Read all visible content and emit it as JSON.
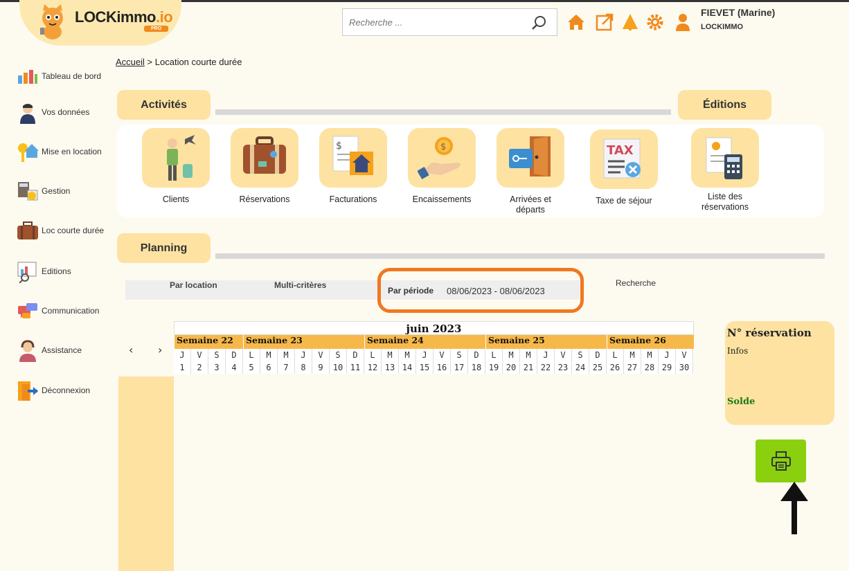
{
  "app": {
    "logo_text_main": "LOCKimmo",
    "logo_text_io": ".io",
    "logo_badge": "PRO"
  },
  "search": {
    "placeholder": "Recherche ...",
    "value": ""
  },
  "user": {
    "name": "FIEVET (Marine)",
    "org": "LOCKIMMO"
  },
  "top_icons": [
    "home-icon",
    "external-link-icon",
    "alert-icon",
    "gear-icon",
    "user-icon"
  ],
  "sidebar": {
    "items": [
      {
        "label": "Tableau de bord",
        "icon": "dashboard-icon"
      },
      {
        "label": "Vos données",
        "icon": "person-icon"
      },
      {
        "label": "Mise en location",
        "icon": "key-house-icon"
      },
      {
        "label": "Gestion",
        "icon": "calculator-icon"
      },
      {
        "label": "Loc courte durée",
        "icon": "suitcase-icon"
      },
      {
        "label": "Editions",
        "icon": "report-icon"
      },
      {
        "label": "Communication",
        "icon": "chat-icon"
      },
      {
        "label": "Assistance",
        "icon": "support-icon"
      },
      {
        "label": "Déconnexion",
        "icon": "logout-icon"
      }
    ]
  },
  "breadcrumb": {
    "home": "Accueil",
    "sep": ">",
    "current": "Location courte durée"
  },
  "sections": {
    "activites": "Activités",
    "editions": "Éditions",
    "planning": "Planning"
  },
  "activities": [
    {
      "label": "Clients",
      "icon": "traveler-icon"
    },
    {
      "label": "Réservations",
      "icon": "suitcase-icon"
    },
    {
      "label": "Facturations",
      "icon": "invoice-house-icon"
    },
    {
      "label": "Encaissements",
      "icon": "coin-hand-icon"
    },
    {
      "label": "Arrivées et départs",
      "icon": "key-door-icon"
    },
    {
      "label": "Taxe de séjour",
      "icon": "tax-icon"
    }
  ],
  "editions": [
    {
      "label": "Liste des réservations",
      "icon": "list-calculator-icon"
    }
  ],
  "planning": {
    "tabs": {
      "by_location": "Par location",
      "multi": "Multi-critères",
      "by_period": "Par période",
      "search": "Recherche"
    },
    "period_value": "08/06/2023 - 08/06/2023",
    "nav_prev": "‹",
    "nav_next": "›",
    "month": "juin 2023",
    "weeks": [
      {
        "label": "Semaine 22",
        "days": 4
      },
      {
        "label": "Semaine 23",
        "days": 7
      },
      {
        "label": "Semaine 24",
        "days": 7
      },
      {
        "label": "Semaine 25",
        "days": 7
      },
      {
        "label": "Semaine 26",
        "days": 5
      }
    ],
    "day_letters": [
      "J",
      "V",
      "S",
      "D",
      "L",
      "M",
      "M",
      "J",
      "V",
      "S",
      "D",
      "L",
      "M",
      "M",
      "J",
      "V",
      "S",
      "D",
      "L",
      "M",
      "M",
      "J",
      "V",
      "S",
      "D",
      "L",
      "M",
      "M",
      "J",
      "V"
    ],
    "day_numbers": [
      "1",
      "2",
      "3",
      "4",
      "5",
      "6",
      "7",
      "8",
      "9",
      "10",
      "11",
      "12",
      "13",
      "14",
      "15",
      "16",
      "17",
      "18",
      "19",
      "20",
      "21",
      "22",
      "23",
      "24",
      "25",
      "26",
      "27",
      "28",
      "29",
      "30"
    ]
  },
  "reservation_panel": {
    "title": "N° réservation",
    "infos": "Infos",
    "solde": "Solde"
  },
  "colors": {
    "accent": "#fde2a2",
    "orange": "#f08a1c",
    "highlight": "#f07820",
    "print": "#8ad00e",
    "solde": "#1a7a1a"
  }
}
